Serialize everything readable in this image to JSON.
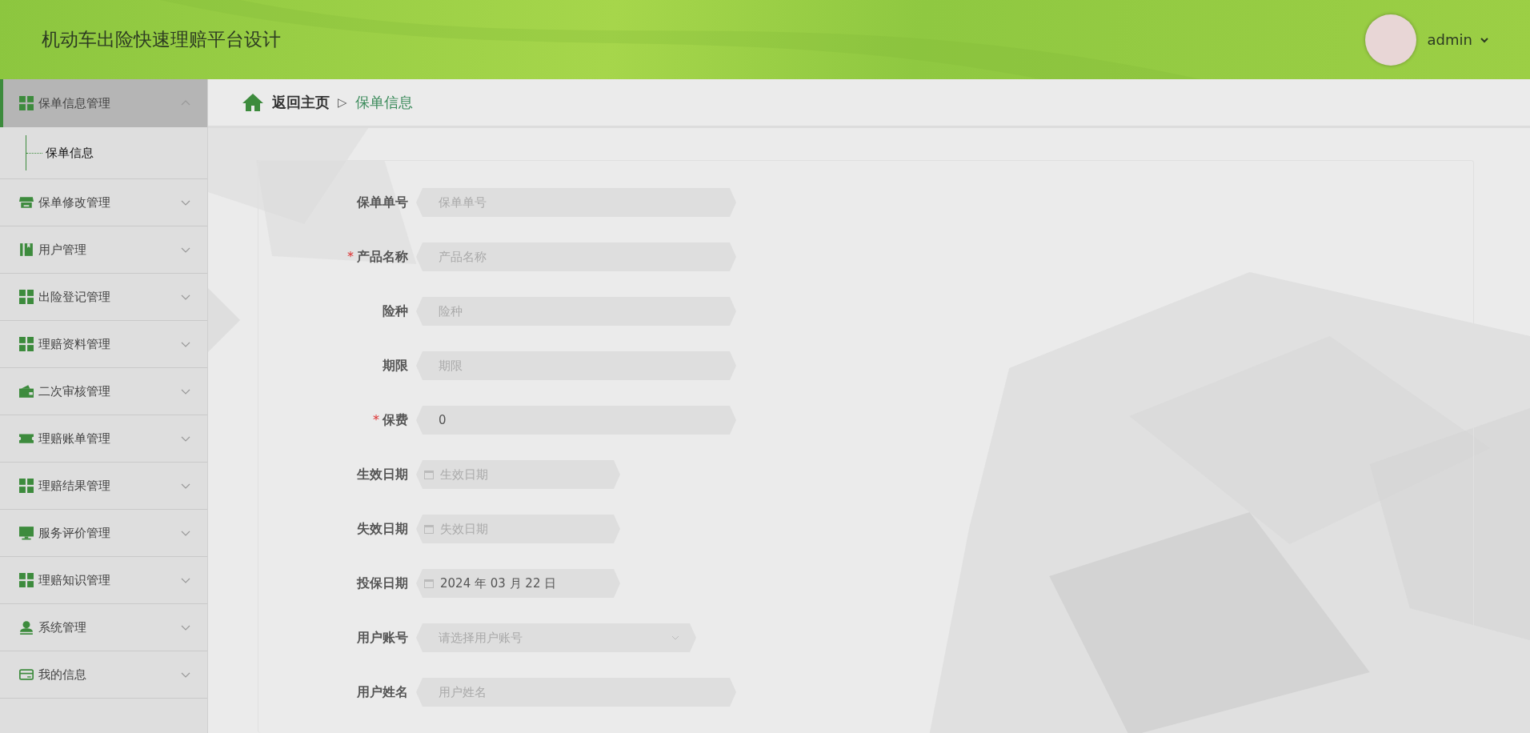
{
  "header": {
    "title": "机动车出险快速理赔平台设计",
    "user": "admin"
  },
  "sidebar": {
    "items": [
      {
        "label": "保单信息管理",
        "expanded": true,
        "selected": true,
        "children": [
          {
            "label": "保单信息",
            "selected": true
          }
        ]
      },
      {
        "label": "保单修改管理",
        "expanded": false,
        "selected": false
      },
      {
        "label": "用户管理",
        "expanded": false,
        "selected": false
      },
      {
        "label": "出险登记管理",
        "expanded": false,
        "selected": false
      },
      {
        "label": "理赔资料管理",
        "expanded": false,
        "selected": false
      },
      {
        "label": "二次审核管理",
        "expanded": false,
        "selected": false
      },
      {
        "label": "理赔账单管理",
        "expanded": false,
        "selected": false
      },
      {
        "label": "理赔结果管理",
        "expanded": false,
        "selected": false
      },
      {
        "label": "服务评价管理",
        "expanded": false,
        "selected": false
      },
      {
        "label": "理赔知识管理",
        "expanded": false,
        "selected": false
      },
      {
        "label": "系统管理",
        "expanded": false,
        "selected": false
      },
      {
        "label": "我的信息",
        "expanded": false,
        "selected": false
      }
    ]
  },
  "breadcrumb": {
    "home": "返回主页",
    "separator": "▷",
    "current": "保单信息"
  },
  "form": {
    "fields": [
      {
        "kind": "text",
        "label": "保单单号",
        "placeholder": "保单单号"
      },
      {
        "kind": "text",
        "label": "产品名称",
        "required_mark": "*",
        "placeholder": "产品名称"
      },
      {
        "kind": "text",
        "label": "险种",
        "placeholder": "险种"
      },
      {
        "kind": "text",
        "label": "期限",
        "placeholder": "期限"
      },
      {
        "kind": "text",
        "label": "保费",
        "required_mark": "*",
        "value": "0"
      },
      {
        "kind": "date",
        "label": "生效日期",
        "placeholder": "生效日期"
      },
      {
        "kind": "date",
        "label": "失效日期",
        "placeholder": "失效日期"
      },
      {
        "kind": "date",
        "label": "投保日期",
        "value": "2024 年 03 月 22 日"
      },
      {
        "kind": "select",
        "label": "用户账号",
        "placeholder": "请选择用户账号"
      },
      {
        "kind": "text",
        "label": "用户姓名",
        "placeholder": "用户姓名"
      }
    ]
  }
}
